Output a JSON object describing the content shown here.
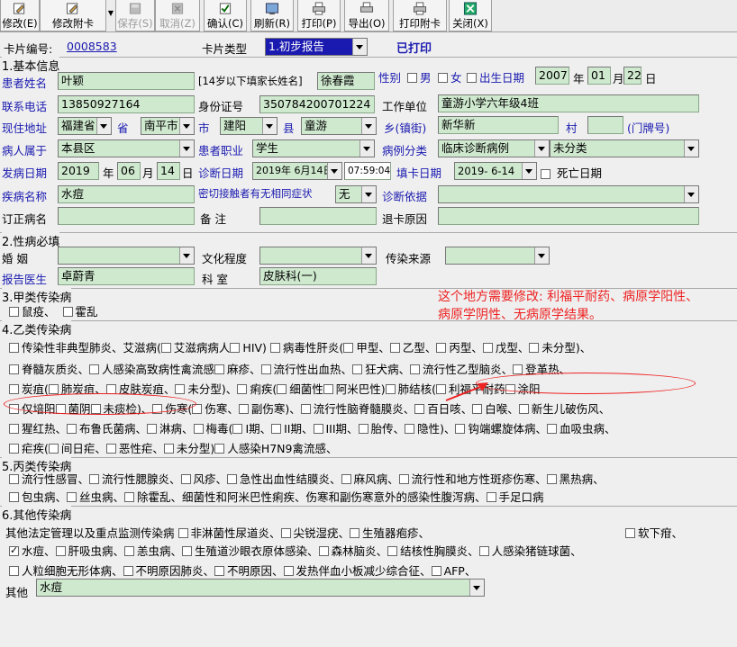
{
  "toolbar": {
    "buttons": [
      {
        "label": "修改(E)",
        "icon": "edit-icon"
      },
      {
        "label": "修改附卡",
        "icon": "edit-attach-icon"
      },
      {
        "label": "保存(S)",
        "icon": "save-icon"
      },
      {
        "label": "取消(Z)",
        "icon": "cancel-icon"
      },
      {
        "label": "确认(C)",
        "icon": "confirm-icon"
      },
      {
        "label": "刷新(R)",
        "icon": "refresh-icon"
      },
      {
        "label": "打印(P)",
        "icon": "print-icon"
      },
      {
        "label": "导出(O)",
        "icon": "export-icon"
      },
      {
        "label": "打印附卡",
        "icon": "print-attach-icon"
      },
      {
        "label": "关闭(X)",
        "icon": "close-icon"
      }
    ]
  },
  "header": {
    "card_no_label": "卡片编号:",
    "card_no": "0008583",
    "card_type_label": "卡片类型",
    "card_type": "1.初步报告",
    "status": "已打印"
  },
  "s1": {
    "title": "1.基本信息",
    "patient_name_label": "患者姓名",
    "patient_name": "叶颖",
    "guardian_label": "[14岁以下填家长姓名]",
    "guardian": "徐春霞",
    "sex_label": "性别",
    "male": "男",
    "female": "女",
    "birth_label": "出生日期",
    "birth_year": "2007",
    "year_unit": "年",
    "birth_month": "01",
    "month_unit": "月",
    "birth_day": "22",
    "day_unit": "日",
    "phone_label": "联系电话",
    "phone": "13850927164",
    "id_label": "身份证号",
    "id": "350784200701224",
    "work_label": "工作单位",
    "work": "童游小学六年级4班",
    "addr_label": "现住地址",
    "province": "福建省",
    "province_unit": "省",
    "city": "南平市",
    "city_unit": "市",
    "county": "建阳",
    "county_unit": "县",
    "town": "童游",
    "town_unit": "乡(镇街)",
    "village": "新华新",
    "village_unit": "村",
    "house_unit": "(门牌号)",
    "belong_label": "病人属于",
    "belong": "本县区",
    "job_label": "患者职业",
    "job": "学生",
    "case_label": "病例分类",
    "case": "临床诊断病例",
    "case2": "未分类",
    "onset_label": "发病日期",
    "onset_year": "2019",
    "onset_month": "06",
    "onset_day": "14",
    "diag_label": "诊断日期",
    "diag_date": "2019年 6月14日",
    "diag_time": "07:59:04",
    "fill_label": "填卡日期",
    "fill_date": "2019- 6-14",
    "death_label": "死亡日期",
    "disease_label": "疾病名称",
    "disease": "水痘",
    "contact_label": "密切接触者有无相同症状",
    "contact": "无",
    "basis_label": "诊断依据",
    "revise_label": "订正病名",
    "prepare_label": "备    注",
    "return_label": "退卡原因"
  },
  "s2": {
    "title": "2.性病必填",
    "marriage_label": "婚    姻",
    "edu_label": "文化程度",
    "source_label": "传染来源",
    "doctor_label": "报告医生",
    "doctor": "卓蔚青",
    "dept_label": "科    室",
    "dept": "皮肤科(一)"
  },
  "s3": {
    "title": "3.甲类传染病",
    "items": [
      "鼠疫、",
      "霍乱"
    ]
  },
  "note": "这个地方需要修改: 利福平耐药、病原学阳性、病原学阴性、无病原学结果。",
  "s4": {
    "title": "4.乙类传染病",
    "line1": [
      "传染性非典型肺炎、",
      "艾滋病(",
      "艾滋病病人",
      "HIV)",
      "病毒性肝炎(",
      "甲型、",
      "乙型、",
      "丙型、",
      "戊型、",
      "未分型)、"
    ],
    "line2": [
      "脊髓灰质炎、",
      "人感染高致病性禽流感",
      "麻疹、",
      "流行性出血热、",
      "狂犬病、",
      "流行性乙型脑炎、",
      "登革热、"
    ],
    "line3": [
      "炭疽(",
      "肺炭疽、",
      "皮肤炭疽、",
      "未分型)、",
      "痢疾(",
      "细菌性",
      "阿米巴性)",
      "肺结核(",
      "利福平耐药",
      "涂阳"
    ],
    "line4": [
      "仅培阳",
      "菌阴",
      "未痰检)、",
      "伤寒(",
      "伤寒、",
      "副伤寒)、",
      "流行性脑脊髓膜炎、",
      "百日咳、",
      "白喉、",
      "新生儿破伤风、"
    ],
    "line5": [
      "猩红热、",
      "布鲁氏菌病、",
      "淋病、",
      "梅毒(",
      "I期、",
      "II期、",
      "III期、",
      "胎传、",
      "隐性)、",
      "钩端螺旋体病、",
      "血吸虫病、"
    ],
    "line6": [
      "疟疾(",
      "间日疟、",
      "恶性疟、",
      "未分型)",
      "人感染H7N9禽流感、"
    ]
  },
  "s5": {
    "title": "5.丙类传染病",
    "line1": [
      "流行性感冒、",
      "流行性腮腺炎、",
      "风疹、",
      "急性出血性结膜炎、",
      "麻风病、",
      "流行性和地方性斑疹伤寒、",
      "黑热病、"
    ],
    "line2": [
      "包虫病、",
      "丝虫病、",
      "除霍乱、细菌性和阿米巴性痢疾、伤寒和副伤寒意外的感染性腹泻病、",
      "手足口病"
    ]
  },
  "s6": {
    "title": "6.其他传染病",
    "line1": [
      "其他法定管理以及重点监测传染病",
      "非淋菌性尿道炎、",
      "尖锐湿疣、",
      "生殖器疱疹、",
      "软下疳、"
    ],
    "line2": [
      "水痘、",
      "肝吸虫病、",
      "恙虫病、",
      "生殖道沙眼衣原体感染、",
      "森林脑炎、",
      "结核性胸膜炎、",
      "人感染猪链球菌、"
    ],
    "line3": [
      "人粒细胞无形体病、",
      "不明原因肺炎、",
      "不明原因、",
      "发热伴血小板减少综合征、",
      "AFP、"
    ],
    "other_label": "其他",
    "other": "水痘"
  },
  "colors": {
    "field_bg": "#cfe9cf",
    "label_blue": "#1a1ab0",
    "annotation_red": "#e22222"
  }
}
